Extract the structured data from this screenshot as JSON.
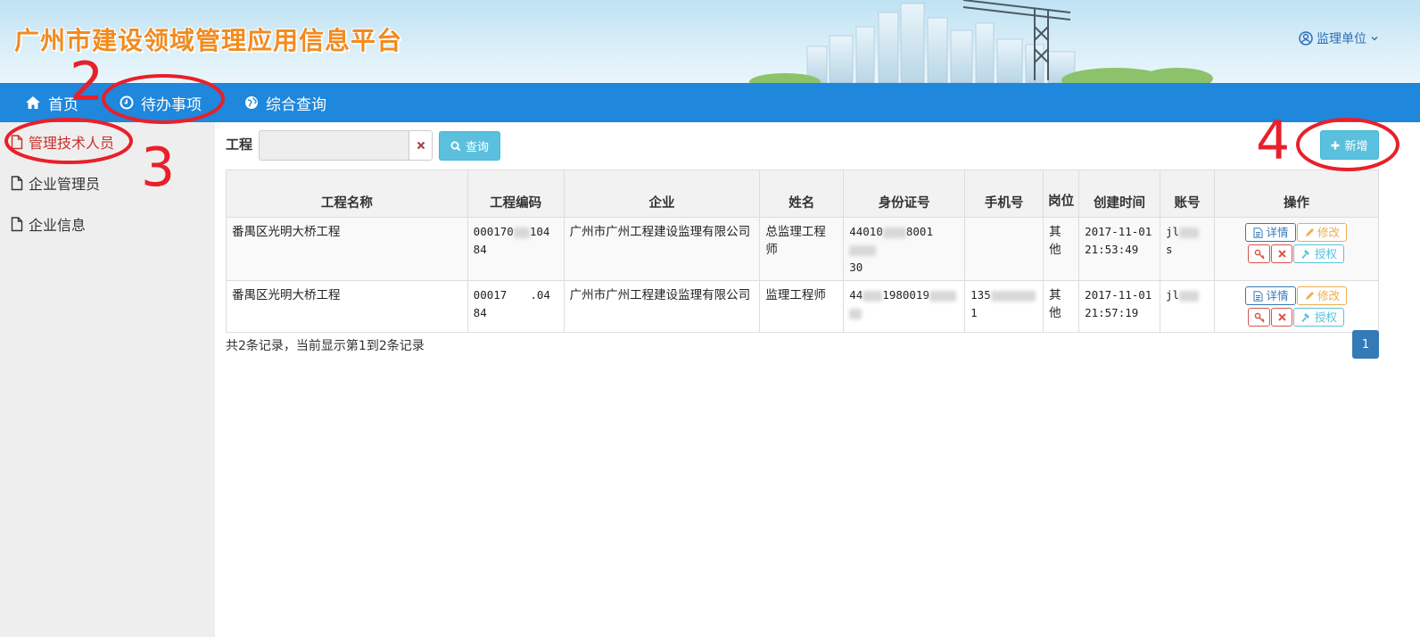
{
  "header": {
    "title": "广州市建设领域管理应用信息平台",
    "user_label": "监理单位"
  },
  "nav": {
    "items": [
      {
        "label": "首页",
        "icon": "home-icon"
      },
      {
        "label": "待办事项",
        "icon": "clock-icon"
      },
      {
        "label": "综合查询",
        "icon": "globe-icon"
      }
    ]
  },
  "sidebar": {
    "items": [
      {
        "label": "管理技术人员",
        "active": true
      },
      {
        "label": "企业管理员",
        "active": false
      },
      {
        "label": "企业信息",
        "active": false
      }
    ]
  },
  "search": {
    "label": "工程",
    "value": "",
    "query_label": "查询",
    "add_label": "新增"
  },
  "table": {
    "columns": [
      "工程名称",
      "工程编码",
      "企业",
      "姓名",
      "身份证号",
      "手机号",
      "岗位",
      "创建时间",
      "账号",
      "操作"
    ],
    "rows": [
      {
        "project": "番禺区光明大桥工程",
        "code_a": "000170",
        "code_b": "104",
        "code_c": "84",
        "company": "广州市广州工程建设监理有限公司",
        "name": "总监理工程师",
        "id_a": "44010",
        "id_b": "8001",
        "id_c": "30",
        "phone_a": "",
        "phone_b": "",
        "post": "其他",
        "created": "2017-11-01 21:53:49",
        "account_a": "jl",
        "account_b": "s"
      },
      {
        "project": "番禺区光明大桥工程",
        "code_a": "00017",
        "code_b": ".04",
        "code_c": "84",
        "company": "广州市广州工程建设监理有限公司",
        "name": "监理工程师",
        "id_a": "44",
        "id_b": "1980019",
        "id_c": "",
        "phone_a": "135",
        "phone_b": "1",
        "post": "其他",
        "created": "2017-11-01 21:57:19",
        "account_a": "jl",
        "account_b": ""
      }
    ],
    "ops": {
      "detail": "详情",
      "edit": "修改",
      "auth": "授权"
    }
  },
  "footer": {
    "summary": "共2条记录，当前显示第1到2条记录",
    "page": "1"
  },
  "annotations": [
    "2",
    "3",
    "4"
  ],
  "colors": {
    "navbar": "#1f87dc",
    "brand": "#f28b1f",
    "annotation": "#e8202a",
    "info_button": "#5bc0de"
  }
}
